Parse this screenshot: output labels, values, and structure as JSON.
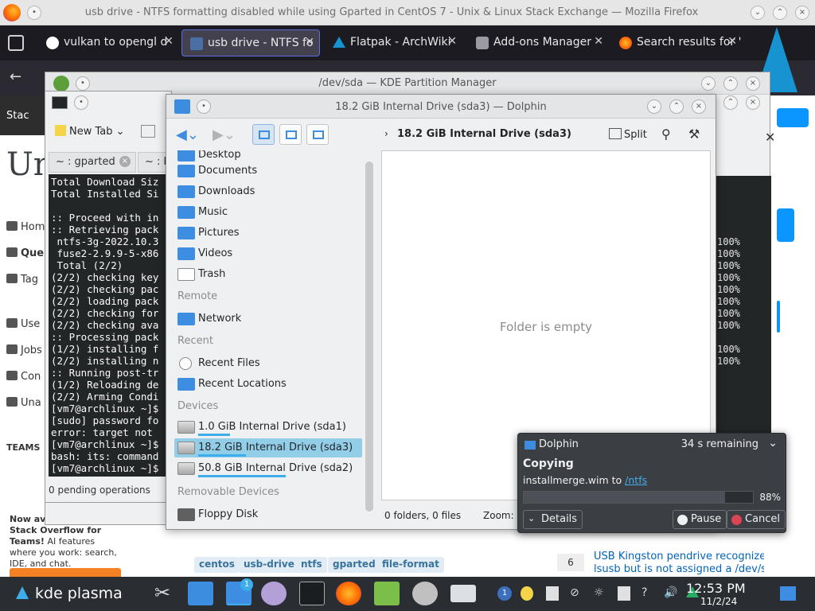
{
  "firefox": {
    "window_title": "usb drive - NTFS formatting disabled while using Gparted in CentOS 7 - Unix & Linux Stack Exchange — Mozilla Firefox",
    "tabs": [
      {
        "label": "vulkan to opengl d"
      },
      {
        "label": "usb drive - NTFS fo"
      },
      {
        "label": "Flatpak - ArchWiki"
      },
      {
        "label": "Add-ons Manager"
      },
      {
        "label": "Search results for '"
      }
    ]
  },
  "se_page": {
    "topbar_label": "Stac",
    "logo_fragment": "Un",
    "sidebar": [
      "Hom",
      "Que",
      "Tag",
      "Use",
      "Jobs",
      "Con",
      "Una"
    ],
    "teams_label": "TEAMS",
    "promo_bold": "Now available on Stack Overflow for Teams!",
    "promo_text": " AI features where you work: search, IDE, and chat.",
    "tags": [
      "centos",
      "usb-drive",
      "ntfs",
      "gparted",
      "file-format"
    ],
    "related_count": "6",
    "related_title": "USB Kingston pendrive recognized by lsusb but is not assigned a /dev/sd* path"
  },
  "partition_manager": {
    "title": "/dev/sda — KDE Partition Manager",
    "percent_lines": [
      "100%",
      "100%",
      "100%",
      "100%",
      "100%",
      "100%",
      "100%",
      "100%",
      "",
      "100%",
      "100%"
    ]
  },
  "konsole": {
    "new_tab_label": "New Tab",
    "tabs": [
      {
        "label": "~ : gparted"
      },
      {
        "label": "~ : b"
      }
    ],
    "terminal_lines": [
      "Total Download Siz",
      "Total Installed Si",
      "",
      ":: Proceed with in",
      ":: Retrieving pack",
      " ntfs-3g-2022.10.3",
      " fuse2-2.9.9-5-x86",
      " Total (2/2)",
      "(2/2) checking key",
      "(2/2) checking pac",
      "(2/2) loading pack",
      "(2/2) checking for",
      "(2/2) checking ava",
      ":: Processing pack",
      "(1/2) installing f",
      "(2/2) installing n",
      ":: Running post-tr",
      "(1/2) Reloading de",
      "(2/2) Arming Condi",
      "[vm7@archlinux ~]$",
      "[sudo] password fo",
      "error: target not ",
      "[vm7@archlinux ~]$",
      "bash: its: command",
      "[vm7@archlinux ~]$"
    ],
    "status": "0 pending operations"
  },
  "dolphin": {
    "title": "18.2 GiB Internal Drive (sda3) — Dolphin",
    "breadcrumb": "18.2 GiB Internal Drive (sda3)",
    "split_label": "Split",
    "places": [
      {
        "label": "Desktop"
      },
      {
        "label": "Documents"
      },
      {
        "label": "Downloads"
      },
      {
        "label": "Music"
      },
      {
        "label": "Pictures"
      },
      {
        "label": "Videos"
      },
      {
        "label": "Trash"
      }
    ],
    "remote_header": "Remote",
    "remote": [
      {
        "label": "Network"
      }
    ],
    "recent_header": "Recent",
    "recent": [
      {
        "label": "Recent Files"
      },
      {
        "label": "Recent Locations"
      }
    ],
    "devices_header": "Devices",
    "devices": [
      {
        "label": "1.0 GiB Internal Drive (sda1)",
        "usage": 0.2
      },
      {
        "label": "18.2 GiB Internal Drive (sda3)",
        "usage": 0.3
      },
      {
        "label": "50.8 GiB Internal Drive (sda2)",
        "usage": 0.55
      }
    ],
    "removable_header": "Removable Devices",
    "removable": [
      {
        "label": "Floppy Disk"
      }
    ],
    "empty_text": "Folder is empty",
    "status_text": "0 folders, 0 files",
    "zoom_label": "Zoom:"
  },
  "notification": {
    "app": "Dolphin",
    "remaining": "34 s remaining",
    "heading": "Copying",
    "message_prefix": "installmerge.wim to ",
    "message_link": "/ntfs",
    "progress": 0.88,
    "percent_text": "88%",
    "details_label": "Details",
    "pause_label": "Pause",
    "cancel_label": "Cancel"
  },
  "taskbar": {
    "start_label": "kde plasma",
    "badge": "1",
    "tray_badge": "1",
    "time": "12:53 PM",
    "date": "11/2/24"
  },
  "colors": {
    "kde_accent": "#3daee9",
    "taskbar_bg": "#2a2e32",
    "terminal_bg": "#232627",
    "firefox_tabbar": "#1c1b22"
  }
}
